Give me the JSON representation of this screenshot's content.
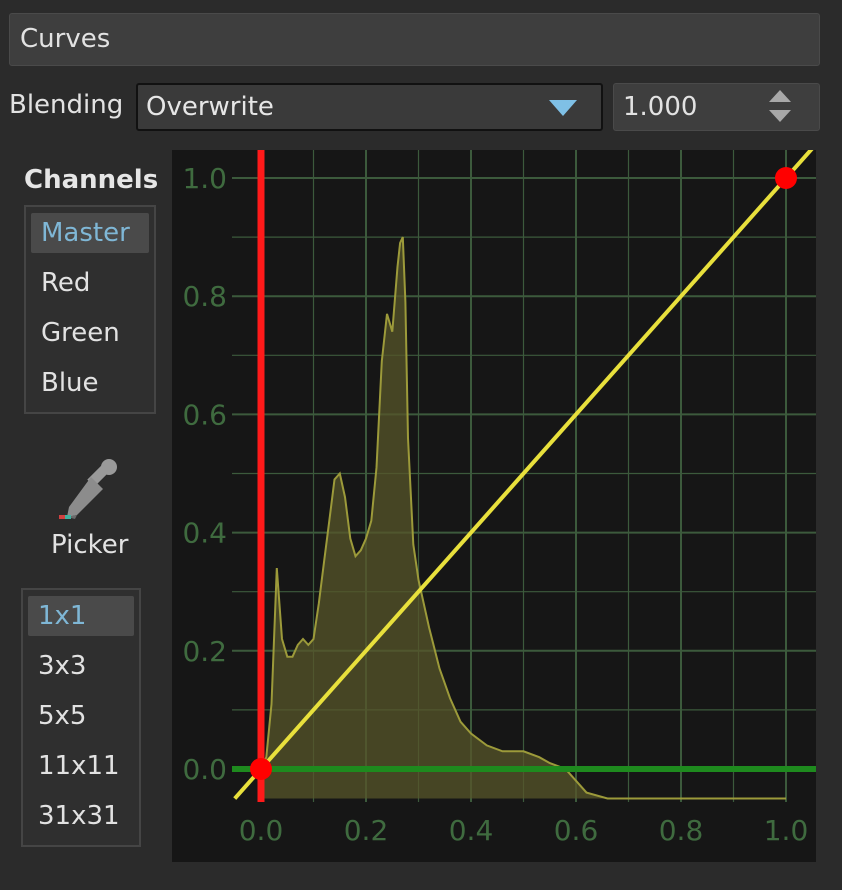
{
  "panel": {
    "title": "Curves"
  },
  "blending": {
    "label": "Blending",
    "mode": "Overwrite",
    "opacity": "1.000"
  },
  "channels": {
    "title": "Channels",
    "items": [
      "Master",
      "Red",
      "Green",
      "Blue"
    ],
    "selected": "Master"
  },
  "picker": {
    "label": "Picker",
    "sizes": [
      "1x1",
      "3x3",
      "5x5",
      "11x11",
      "31x31"
    ],
    "selected": "1x1"
  },
  "chart_data": {
    "type": "line",
    "title": "",
    "xlabel": "",
    "ylabel": "",
    "xlim": [
      0,
      1
    ],
    "ylim": [
      0,
      1
    ],
    "x_tick_labels": [
      "0.0",
      "0.2",
      "0.4",
      "0.6",
      "0.8",
      "1.0"
    ],
    "y_tick_labels": [
      "0.0",
      "0.2",
      "0.4",
      "0.6",
      "0.8",
      "1.0"
    ],
    "grid": true,
    "curve_points": [
      [
        0.0,
        0.0
      ],
      [
        1.0,
        1.0
      ]
    ],
    "histogram": {
      "x": [
        0.0,
        0.01,
        0.02,
        0.03,
        0.04,
        0.05,
        0.06,
        0.07,
        0.08,
        0.09,
        0.1,
        0.11,
        0.12,
        0.13,
        0.14,
        0.15,
        0.16,
        0.17,
        0.18,
        0.19,
        0.2,
        0.21,
        0.22,
        0.23,
        0.24,
        0.25,
        0.26,
        0.265,
        0.27,
        0.275,
        0.28,
        0.29,
        0.3,
        0.32,
        0.34,
        0.36,
        0.38,
        0.4,
        0.43,
        0.46,
        0.5,
        0.53,
        0.55,
        0.58,
        0.62,
        0.66,
        0.7,
        0.8,
        0.9,
        1.0
      ],
      "y": [
        0.0,
        0.02,
        0.11,
        0.34,
        0.22,
        0.19,
        0.19,
        0.21,
        0.22,
        0.21,
        0.22,
        0.28,
        0.35,
        0.42,
        0.49,
        0.5,
        0.46,
        0.39,
        0.36,
        0.37,
        0.39,
        0.42,
        0.51,
        0.69,
        0.77,
        0.74,
        0.85,
        0.89,
        0.9,
        0.79,
        0.56,
        0.38,
        0.32,
        0.24,
        0.17,
        0.12,
        0.08,
        0.06,
        0.04,
        0.03,
        0.03,
        0.02,
        0.01,
        0.0,
        -0.04,
        -0.05,
        -0.05,
        -0.05,
        -0.05,
        -0.05
      ]
    },
    "colors": {
      "curve": "#e8e03c",
      "x_axis_marker": "#ff1a1a",
      "y_axis_marker": "#1e8a1e",
      "control_point": "#ff0000",
      "grid": "#3c5a3c",
      "histogram_fill": "#57552a"
    }
  }
}
